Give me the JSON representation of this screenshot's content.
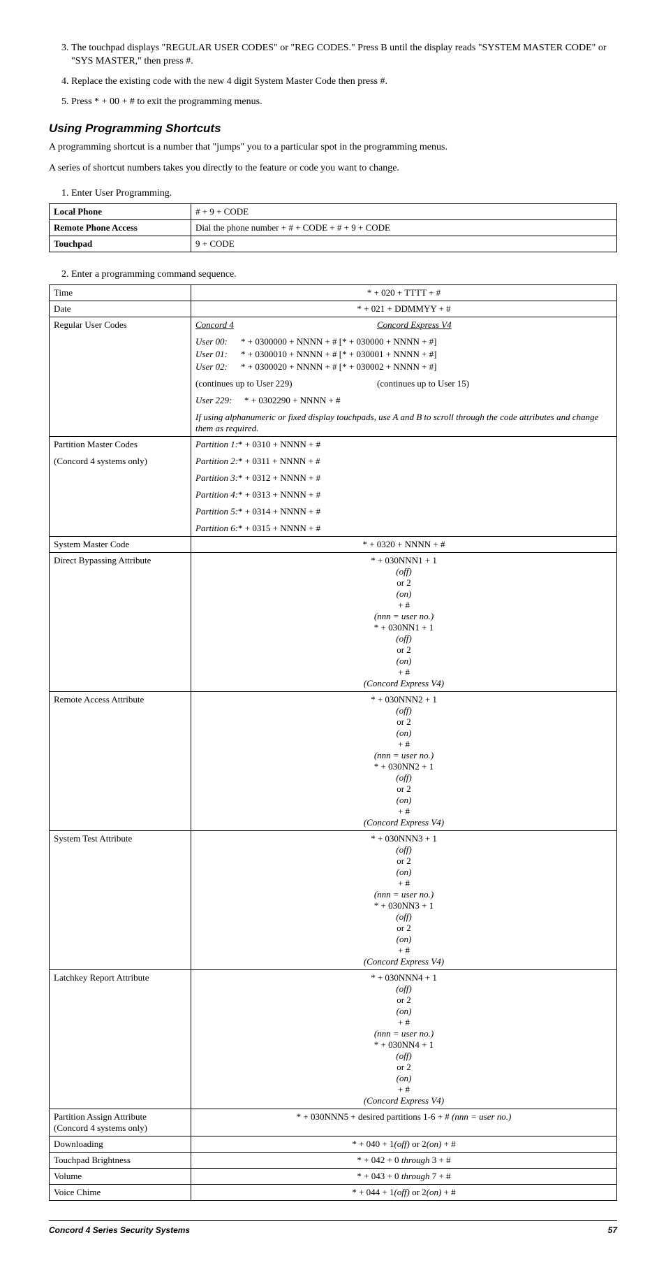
{
  "steps": {
    "s3": "The touchpad displays \"REGULAR USER CODES\" or \"REG CODES.\" Press B until the display reads \"SYSTEM MASTER CODE\" or \"SYS MASTER,\" then press #.",
    "s4": "Replace the existing code with the new 4 digit System Master Code then press #.",
    "s5": "Press * + 00 + # to exit the programming menus."
  },
  "heading": "Using Programming Shortcuts",
  "para1": "A programming shortcut is a number that \"jumps\" you to a particular spot in the programming menus.",
  "para2": "A series of shortcut numbers takes you directly to the feature or code you want to change.",
  "step1_label": "Enter User Programming.",
  "table1": {
    "r1c1": "Local Phone",
    "r1c2": "# + 9 + CODE",
    "r2c1": "Remote Phone Access",
    "r2c2": "Dial the phone number + # + CODE + # + 9 + CODE",
    "r3c1": "Touchpad",
    "r3c2": "9 + CODE"
  },
  "step2_label": "Enter a programming command sequence.",
  "table2": {
    "time_lbl": "Time",
    "time_val": "* + 020 + TTTT + #",
    "date_lbl": "Date",
    "date_val": "* + 021 + DDMMYY + #",
    "ruc_lbl": "Regular User Codes",
    "ruc_hdr_left": "Concord 4",
    "ruc_hdr_right": "Concord Express V4",
    "ruc_u00_lbl": "User 00:",
    "ruc_u00_val": "* + 0300000 + NNNN + # [* + 030000 + NNNN + #]",
    "ruc_u01_lbl": "User 01:",
    "ruc_u01_val": "* + 0300010 + NNNN + # [* + 030001 + NNNN + #]",
    "ruc_u02_lbl": "User 02:",
    "ruc_u02_val": "* + 0300020 + NNNN + # [* + 030002 + NNNN + #]",
    "ruc_cont_left": "(continues up to User 229)",
    "ruc_cont_right": "(continues up to User 15)",
    "ruc_u229_lbl": "User 229:",
    "ruc_u229_val": "* + 0302290 + NNNN + #",
    "ruc_note": "If using alphanumeric or fixed display touchpads, use A and B to scroll through the code attributes and change them as required.",
    "pmc_lbl1": "Partition Master Codes",
    "pmc_lbl2": "(Concord 4 systems only)",
    "pmc_p1_it": "Partition 1:",
    "pmc_p1_rest": "* + 0310 + NNNN + #",
    "pmc_p2_it": "Partition 2:",
    "pmc_p2_rest": "* + 0311 + NNNN + #",
    "pmc_p3_it": "Partition 3:",
    "pmc_p3_rest": "* + 0312 + NNNN + #",
    "pmc_p4_it": "Partition 4:",
    "pmc_p4_rest": "* + 0313 + NNNN + #",
    "pmc_p5_it": "Partition 5:",
    "pmc_p5_rest": "* + 0314 + NNNN + #",
    "pmc_p6_it": "Partition 6:",
    "pmc_p6_rest": "* + 0315 + NNNN + #",
    "smc_lbl": "System Master Code",
    "smc_val": "* + 0320 + NNNN + #",
    "dba_lbl": "Direct Bypassing Attribute",
    "dba_l1_a": "* + 030NNN1 + 1",
    "dba_l1_b": "(off)",
    "dba_l1_c": " or 2",
    "dba_l1_d": "(on)",
    "dba_l1_e": " + # ",
    "dba_l1_f": "(nnn = user no.)",
    "dba_l2_a": "* + 030NN1 + 1",
    "dba_l2_b": "(off)",
    "dba_l2_c": " or 2",
    "dba_l2_d": "(on)",
    "dba_l2_e": " + # ",
    "dba_l2_f": "(Concord Express V4)",
    "raa_lbl": "Remote Access Attribute",
    "raa_l1_a": "* + 030NNN2 + 1",
    "raa_l1_b": "(off)",
    "raa_l1_c": " or 2",
    "raa_l1_d": "(on)",
    "raa_l1_e": " + # ",
    "raa_l1_f": "(nnn = user no.)",
    "raa_l2_a": "* + 030NN2 + 1",
    "raa_l2_b": "(off)",
    "raa_l2_c": " or 2",
    "raa_l2_d": "(on)",
    "raa_l2_e": " + # ",
    "raa_l2_f": "(Concord Express V4)",
    "sta_lbl": "System Test Attribute",
    "sta_l1_a": "* + 030NNN3 + 1",
    "sta_l1_b": "(off)",
    "sta_l1_c": " or 2",
    "sta_l1_d": "(on)",
    "sta_l1_e": " + # ",
    "sta_l1_f": "(nnn = user no.)",
    "sta_l2_a": "* + 030NN3 + 1",
    "sta_l2_b": "(off)",
    "sta_l2_c": " or 2",
    "sta_l2_d": "(on)",
    "sta_l2_e": " + # ",
    "sta_l2_f": "(Concord Express V4)",
    "lra_lbl": "Latchkey Report Attribute",
    "lra_l1_a": "* + 030NNN4 + 1",
    "lra_l1_b": "(off)",
    "lra_l1_c": " or 2",
    "lra_l1_d": "(on)",
    "lra_l1_e": " + # ",
    "lra_l1_f": "(nnn = user no.)",
    "lra_l2_a": "* + 030NN4 + 1",
    "lra_l2_b": "(off)",
    "lra_l2_c": " or 2",
    "lra_l2_d": "(on)",
    "lra_l2_e": " + # ",
    "lra_l2_f": "(Concord Express V4)",
    "paa_lbl1": "Partition Assign Attribute",
    "paa_lbl2": "(Concord 4 systems only)",
    "paa_a": "* + 030NNN5 + desired partitions 1-6 + # ",
    "paa_b": "(nnn = user no.)",
    "dl_lbl": "Downloading",
    "dl_a": "* + 040 + 1",
    "dl_b": "(off)",
    "dl_c": " or 2",
    "dl_d": "(on)",
    "dl_e": " + #",
    "tb_lbl": "Touchpad Brightness",
    "tb_a": "* + 042 + 0 ",
    "tb_b": "through",
    "tb_c": " 3 + #",
    "vol_lbl": "Volume",
    "vol_a": "* + 043 + 0 ",
    "vol_b": "through",
    "vol_c": " 7 + #",
    "vc_lbl": "Voice Chime",
    "vc_a": "* + 044 + 1",
    "vc_b": "(off)",
    "vc_c": " or 2",
    "vc_d": "(on)",
    "vc_e": " + #"
  },
  "footer_left": "Concord 4 Series Security Systems",
  "footer_right": "57"
}
